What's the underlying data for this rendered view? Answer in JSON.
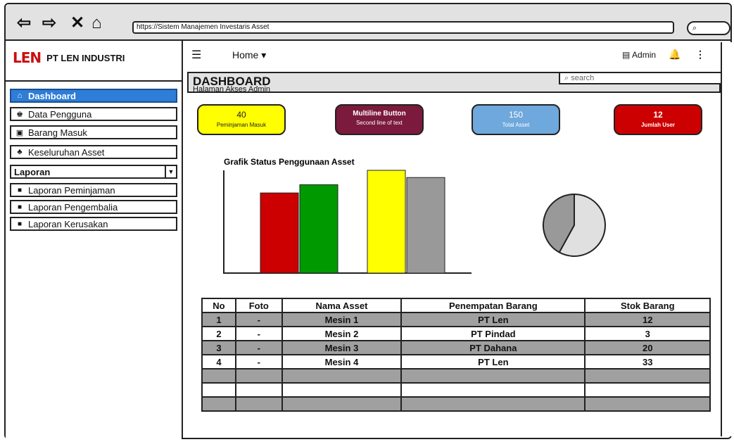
{
  "browser": {
    "url": "https://Sistem Manajemen Investaris Asset",
    "back_icon": "back-arrow-icon",
    "forward_icon": "forward-arrow-icon",
    "close_icon": "close-icon",
    "home_icon": "home-icon",
    "search_icon": "search-icon"
  },
  "brand": {
    "logo": "LEN",
    "name": "PT LEN INDUSTRI"
  },
  "sidebar": {
    "items": [
      {
        "label": "Dashboard",
        "icon": "home-icon",
        "active": true
      },
      {
        "label": "Data Pengguna",
        "icon": "person-icon"
      },
      {
        "label": "Barang Masuk",
        "icon": "box-icon"
      },
      {
        "label": "Keseluruhan Asset",
        "icon": "tree-icon"
      },
      {
        "label": "Laporan",
        "icon": ""
      },
      {
        "label": "Laporan Peminjaman",
        "icon": "report-icon"
      },
      {
        "label": "Laporan Pengembalia",
        "icon": "report-icon"
      },
      {
        "label": "Laporan Kerusakan",
        "icon": "report-icon"
      }
    ]
  },
  "appbar": {
    "menu_icon": "hamburger-icon",
    "home": "Home",
    "admin": "Admin",
    "bell_icon": "bell-icon",
    "more_icon": "more-icon"
  },
  "header": {
    "title": "DASHBOARD",
    "subtitle": "Halaman Akses Admin",
    "search_placeholder": "search"
  },
  "cards": [
    {
      "number": "40",
      "label": "Peminjaman Masuk",
      "color": "#ffff00",
      "text": "#222222"
    },
    {
      "number": "Multiline Button",
      "label": "Second line of text",
      "color": "#7b1a3c",
      "text": "#ffffff"
    },
    {
      "number": "150",
      "label": "Total Asset",
      "color": "#6fa8dc",
      "text": "#ffffff"
    },
    {
      "number": "12",
      "label": "Jumlah User",
      "color": "#cc0000",
      "text": "#ffffff"
    }
  ],
  "chart_data": [
    {
      "type": "bar",
      "title": "Grafik Status Penggunaan Asset",
      "series": [
        {
          "color": "#cc0000",
          "values": [
            0.78
          ]
        },
        {
          "color": "#009900",
          "values": [
            0.86
          ]
        },
        {
          "color": "#ffff00",
          "values": [
            1.0
          ]
        },
        {
          "color": "#999999",
          "values": [
            0.93
          ]
        }
      ],
      "ylim": [
        0,
        1
      ]
    },
    {
      "type": "pie",
      "values": [
        0.42,
        0.58
      ],
      "colors": [
        "#999999",
        "#e0e0e0"
      ]
    }
  ],
  "table": {
    "headers": [
      "No",
      "Foto",
      "Nama Asset",
      "Penempatan Barang",
      "Stok Barang"
    ],
    "rows": [
      [
        "1",
        "-",
        "Mesin 1",
        "PT Len",
        "12"
      ],
      [
        "2",
        "-",
        "Mesin 2",
        "PT Pindad",
        "3"
      ],
      [
        "3",
        "-",
        "Mesin 3",
        "PT Dahana",
        "20"
      ],
      [
        "4",
        "-",
        "Mesin 4",
        "PT Len",
        "33"
      ],
      [
        "",
        "",
        "",
        "",
        ""
      ],
      [
        "",
        "",
        "",
        "",
        ""
      ],
      [
        "",
        "",
        "",
        "",
        ""
      ]
    ]
  }
}
